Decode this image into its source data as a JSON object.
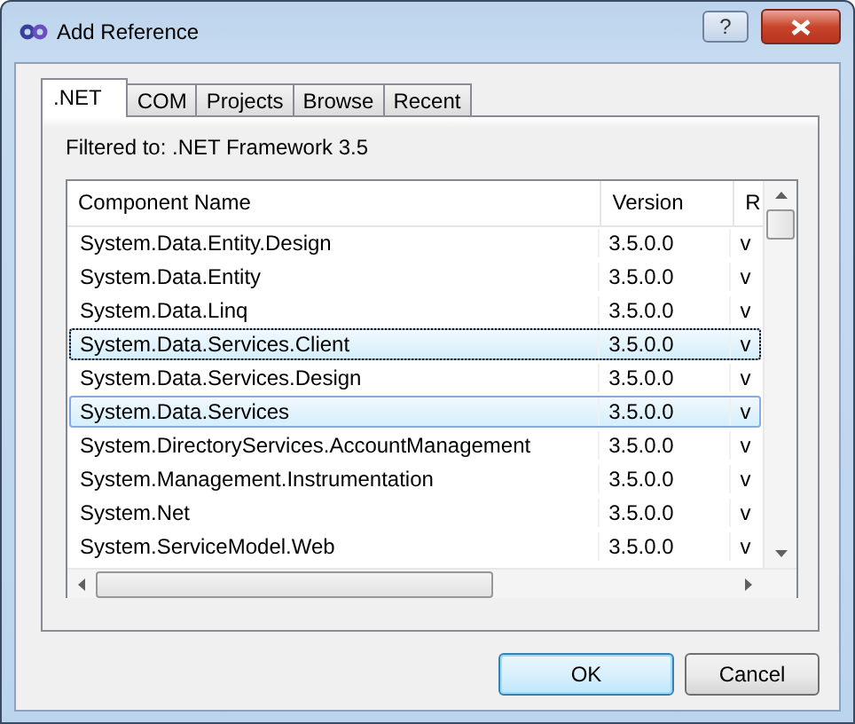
{
  "window": {
    "title": "Add Reference",
    "help_button": "?"
  },
  "tabs": [
    {
      "label": ".NET",
      "selected": true
    },
    {
      "label": "COM",
      "selected": false
    },
    {
      "label": "Projects",
      "selected": false
    },
    {
      "label": "Browse",
      "selected": false
    },
    {
      "label": "Recent",
      "selected": false
    }
  ],
  "filter_label": "Filtered to: .NET Framework 3.5",
  "table": {
    "columns": [
      "Component Name",
      "Version",
      "R"
    ],
    "rows": [
      {
        "cells": [
          "System.Data.Entity.Design",
          "3.5.0.0",
          "v"
        ],
        "selected": false,
        "focused": false
      },
      {
        "cells": [
          "System.Data.Entity",
          "3.5.0.0",
          "v"
        ],
        "selected": false,
        "focused": false
      },
      {
        "cells": [
          "System.Data.Linq",
          "3.5.0.0",
          "v"
        ],
        "selected": false,
        "focused": false
      },
      {
        "cells": [
          "System.Data.Services.Client",
          "3.5.0.0",
          "v"
        ],
        "selected": true,
        "focused": true
      },
      {
        "cells": [
          "System.Data.Services.Design",
          "3.5.0.0",
          "v"
        ],
        "selected": false,
        "focused": false
      },
      {
        "cells": [
          "System.Data.Services",
          "3.5.0.0",
          "v"
        ],
        "selected": true,
        "focused": false
      },
      {
        "cells": [
          "System.DirectoryServices.AccountManagement",
          "3.5.0.0",
          "v"
        ],
        "selected": false,
        "focused": false
      },
      {
        "cells": [
          "System.Management.Instrumentation",
          "3.5.0.0",
          "v"
        ],
        "selected": false,
        "focused": false
      },
      {
        "cells": [
          "System.Net",
          "3.5.0.0",
          "v"
        ],
        "selected": false,
        "focused": false
      },
      {
        "cells": [
          "System.ServiceModel.Web",
          "3.5.0.0",
          "v"
        ],
        "selected": false,
        "focused": false
      }
    ]
  },
  "buttons": [
    {
      "label": "OK",
      "default": true
    },
    {
      "label": "Cancel",
      "default": false
    }
  ]
}
